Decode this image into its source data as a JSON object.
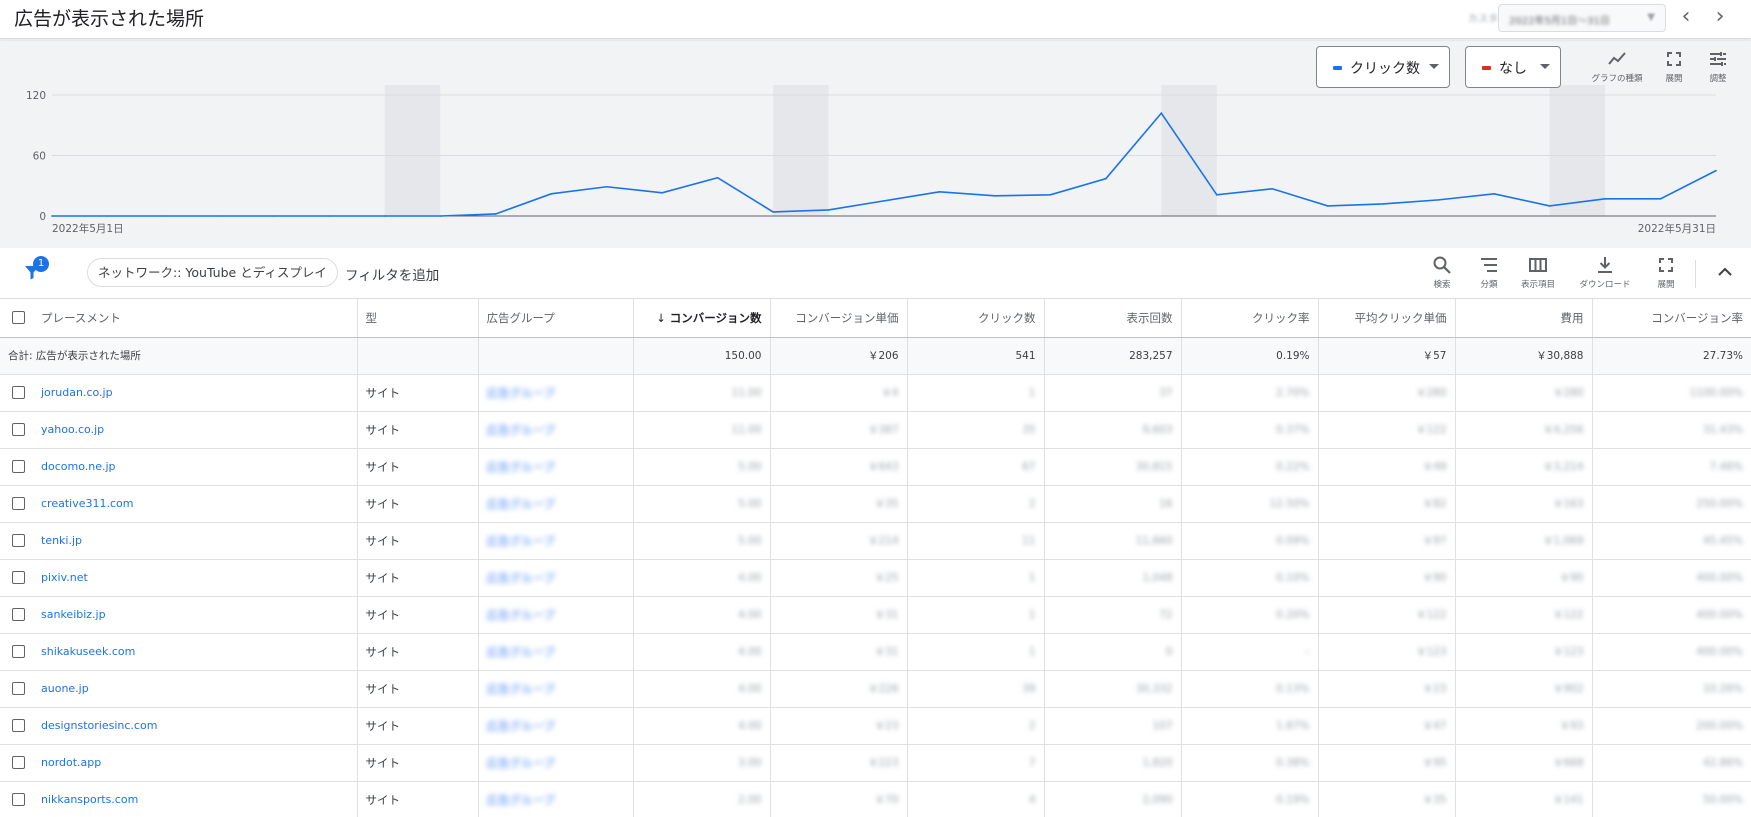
{
  "header": {
    "title": "広告が表示された場所",
    "date_label": "カスタム",
    "date_range": "2022年5月1日〜31日",
    "prev_icon": "chevron-left-icon",
    "next_icon": "chevron-right-icon"
  },
  "chart_controls": {
    "metric1": {
      "label": "クリック数",
      "color": "#1a73e8"
    },
    "metric2": {
      "label": "なし",
      "color": "#d93025"
    },
    "tools": [
      {
        "name": "chart-type",
        "label": "グラフの種類",
        "icon": "trend-line-icon"
      },
      {
        "name": "expand",
        "label": "展開",
        "icon": "fullscreen-icon"
      },
      {
        "name": "adjust",
        "label": "調整",
        "icon": "tune-icon"
      }
    ]
  },
  "chart_data": {
    "type": "line",
    "series": [
      {
        "color": "#1a73e8",
        "values": [
          0,
          0,
          0,
          0,
          0,
          0,
          0,
          0,
          2,
          22,
          29,
          23,
          38,
          4,
          6,
          15,
          24,
          20,
          21,
          37,
          102,
          21,
          27,
          10,
          12,
          16,
          22,
          10,
          17,
          17,
          45
        ]
      }
    ],
    "x": [
      "2022-05-01",
      "2022-05-02",
      "2022-05-03",
      "2022-05-04",
      "2022-05-05",
      "2022-05-06",
      "2022-05-07",
      "2022-05-08",
      "2022-05-09",
      "2022-05-10",
      "2022-05-11",
      "2022-05-12",
      "2022-05-13",
      "2022-05-14",
      "2022-05-15",
      "2022-05-16",
      "2022-05-17",
      "2022-05-18",
      "2022-05-19",
      "2022-05-20",
      "2022-05-21",
      "2022-05-22",
      "2022-05-23",
      "2022-05-24",
      "2022-05-25",
      "2022-05-26",
      "2022-05-27",
      "2022-05-28",
      "2022-05-29",
      "2022-05-30",
      "2022-05-31"
    ],
    "y_ticks": [
      "0",
      "60",
      "120"
    ],
    "ylim": [
      0,
      120
    ],
    "x_start_label": "2022年5月1日",
    "x_end_label": "2022年5月31日",
    "shaded_days": [
      "2022-05-07",
      "2022-05-14",
      "2022-05-21",
      "2022-05-28"
    ],
    "grid": true
  },
  "filter_bar": {
    "badge_count": "1",
    "chip": "ネットワーク:: YouTube とディスプレイ",
    "add_filter": "フィルタを追加",
    "tools": [
      {
        "name": "search",
        "label": "検索",
        "icon": "search-icon"
      },
      {
        "name": "segment",
        "label": "分類",
        "icon": "segment-icon"
      },
      {
        "name": "columns",
        "label": "表示項目",
        "icon": "columns-icon"
      },
      {
        "name": "download",
        "label": "ダウンロード",
        "icon": "download-icon"
      },
      {
        "name": "expand",
        "label": "展開",
        "icon": "fullscreen-icon"
      }
    ]
  },
  "table": {
    "columns": [
      "プレースメント",
      "型",
      "広告グループ",
      "コンバージョン数",
      "コンバージョン単価",
      "クリック数",
      "表示回数",
      "クリック率",
      "平均クリック単価",
      "費用",
      "コンバージョン率"
    ],
    "sorted_column": "コンバージョン数",
    "total": {
      "label": "合計: 広告が表示された場所",
      "conversions": "150.00",
      "cost_per_conv": "￥206",
      "clicks": "541",
      "impressions": "283,257",
      "ctr": "0.19%",
      "avg_cpc": "￥57",
      "cost": "￥30,888",
      "conv_rate": "27.73%"
    },
    "rows": [
      {
        "placement": "jorudan.co.jp",
        "type": "サイト",
        "ad_group": "広告グループ",
        "conversions": "11.00",
        "cost_per_conv": "￥4",
        "clicks": "1",
        "impressions": "37",
        "ctr": "2.70%",
        "avg_cpc": "￥280",
        "cost": "￥280",
        "conv_rate": "1100.00%"
      },
      {
        "placement": "yahoo.co.jp",
        "type": "サイト",
        "ad_group": "広告グループ",
        "conversions": "11.00",
        "cost_per_conv": "￥387",
        "clicks": "35",
        "impressions": "9,603",
        "ctr": "0.37%",
        "avg_cpc": "￥122",
        "cost": "￥4,256",
        "conv_rate": "31.43%"
      },
      {
        "placement": "docomo.ne.jp",
        "type": "サイト",
        "ad_group": "広告グループ",
        "conversions": "5.00",
        "cost_per_conv": "￥643",
        "clicks": "67",
        "impressions": "30,815",
        "ctr": "0.22%",
        "avg_cpc": "￥49",
        "cost": "￥3,214",
        "conv_rate": "7.46%"
      },
      {
        "placement": "creative311.com",
        "type": "サイト",
        "ad_group": "広告グループ",
        "conversions": "5.00",
        "cost_per_conv": "￥35",
        "clicks": "2",
        "impressions": "16",
        "ctr": "12.50%",
        "avg_cpc": "￥82",
        "cost": "￥163",
        "conv_rate": "250.00%"
      },
      {
        "placement": "tenki.jp",
        "type": "サイト",
        "ad_group": "広告グループ",
        "conversions": "5.00",
        "cost_per_conv": "￥214",
        "clicks": "11",
        "impressions": "11,660",
        "ctr": "0.09%",
        "avg_cpc": "￥97",
        "cost": "￥1,069",
        "conv_rate": "45.45%"
      },
      {
        "placement": "pixiv.net",
        "type": "サイト",
        "ad_group": "広告グループ",
        "conversions": "4.00",
        "cost_per_conv": "￥25",
        "clicks": "1",
        "impressions": "1,048",
        "ctr": "0.10%",
        "avg_cpc": "￥90",
        "cost": "￥90",
        "conv_rate": "400.00%"
      },
      {
        "placement": "sankeibiz.jp",
        "type": "サイト",
        "ad_group": "広告グループ",
        "conversions": "4.00",
        "cost_per_conv": "￥31",
        "clicks": "1",
        "impressions": "72",
        "ctr": "0.20%",
        "avg_cpc": "￥122",
        "cost": "￥122",
        "conv_rate": "400.00%"
      },
      {
        "placement": "shikakuseek.com",
        "type": "サイト",
        "ad_group": "広告グループ",
        "conversions": "4.00",
        "cost_per_conv": "￥31",
        "clicks": "1",
        "impressions": "0",
        "ctr": "–",
        "avg_cpc": "￥123",
        "cost": "￥123",
        "conv_rate": "400.00%"
      },
      {
        "placement": "auone.jp",
        "type": "サイト",
        "ad_group": "広告グループ",
        "conversions": "4.00",
        "cost_per_conv": "￥226",
        "clicks": "39",
        "impressions": "30,332",
        "ctr": "0.13%",
        "avg_cpc": "￥23",
        "cost": "￥902",
        "conv_rate": "10.26%"
      },
      {
        "placement": "designstoriesinc.com",
        "type": "サイト",
        "ad_group": "広告グループ",
        "conversions": "4.00",
        "cost_per_conv": "￥23",
        "clicks": "2",
        "impressions": "107",
        "ctr": "1.87%",
        "avg_cpc": "￥47",
        "cost": "￥93",
        "conv_rate": "200.00%"
      },
      {
        "placement": "nordot.app",
        "type": "サイト",
        "ad_group": "広告グループ",
        "conversions": "3.00",
        "cost_per_conv": "￥223",
        "clicks": "7",
        "impressions": "1,820",
        "ctr": "0.38%",
        "avg_cpc": "￥95",
        "cost": "￥668",
        "conv_rate": "42.86%"
      },
      {
        "placement": "nikkansports.com",
        "type": "サイト",
        "ad_group": "広告グループ",
        "conversions": "2.00",
        "cost_per_conv": "￥70",
        "clicks": "4",
        "impressions": "2,090",
        "ctr": "0.19%",
        "avg_cpc": "￥35",
        "cost": "￥141",
        "conv_rate": "50.00%"
      }
    ]
  }
}
